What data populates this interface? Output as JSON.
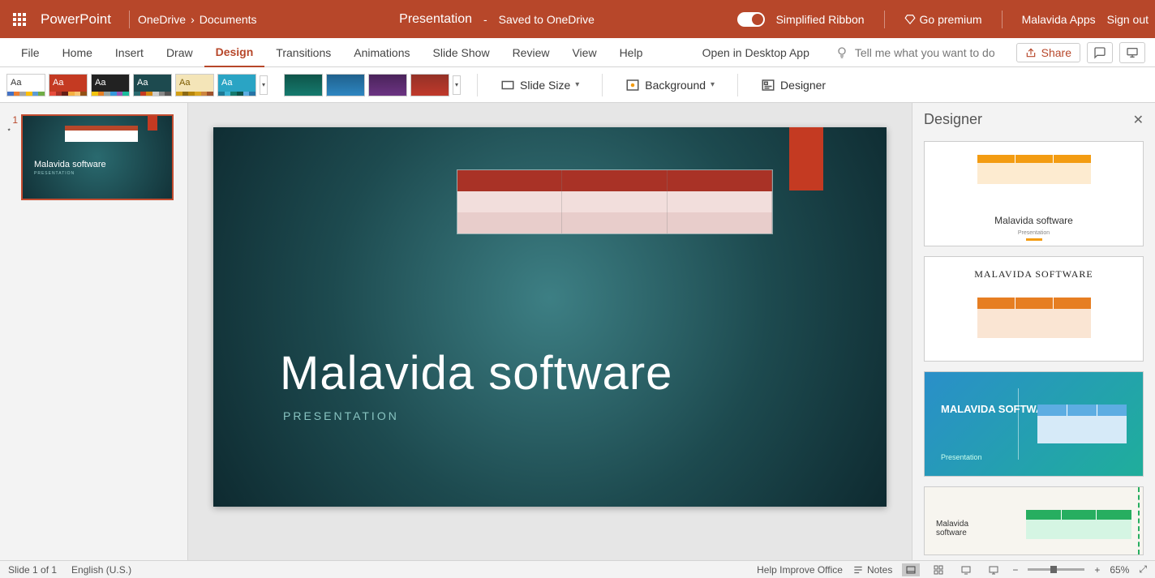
{
  "titlebar": {
    "app_name": "PowerPoint",
    "breadcrumb": [
      "OneDrive",
      "Documents"
    ],
    "doc_name": "Presentation",
    "save_status": "Saved to OneDrive",
    "simplified_ribbon": "Simplified Ribbon",
    "go_premium": "Go premium",
    "account": "Malavida Apps",
    "sign_out": "Sign out"
  },
  "tabs": {
    "items": [
      "File",
      "Home",
      "Insert",
      "Draw",
      "Design",
      "Transitions",
      "Animations",
      "Slide Show",
      "Review",
      "View",
      "Help"
    ],
    "active": "Design",
    "open_desktop": "Open in Desktop App",
    "tell_me": "Tell me what you want to do",
    "share": "Share"
  },
  "ribbon": {
    "slide_size": "Slide Size",
    "background": "Background",
    "designer": "Designer"
  },
  "thumbnails": {
    "slide_number": "1"
  },
  "slide": {
    "title": "Malavida software",
    "subtitle": "PRESENTATION"
  },
  "designer_panel": {
    "title": "Designer",
    "card1_title": "Malavida software",
    "card1_sub": "Presentation",
    "card2_title": "MALAVIDA SOFTWARE",
    "card3_title": "MALAVIDA SOFTWARE",
    "card3_sub": "Presentation",
    "card4_title": "Malavida software"
  },
  "statusbar": {
    "slide_info": "Slide 1 of 1",
    "language": "English (U.S.)",
    "help_improve": "Help Improve Office",
    "notes": "Notes",
    "zoom": "65%"
  }
}
